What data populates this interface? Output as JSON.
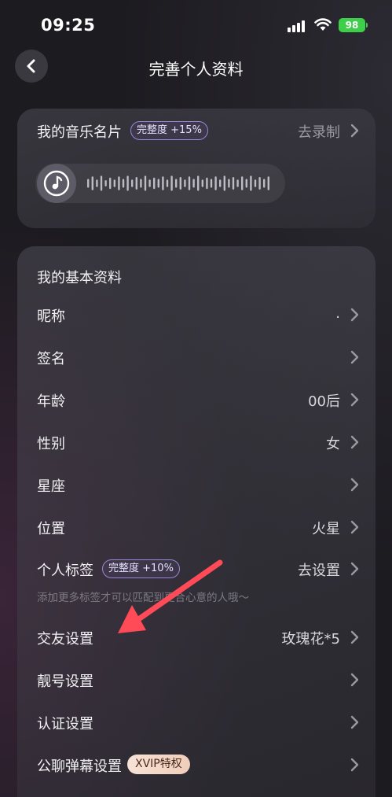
{
  "status_bar": {
    "time": "09:25",
    "battery": "98"
  },
  "header": {
    "title": "完善个人资料"
  },
  "music_card": {
    "title": "我的音乐名片",
    "badge": "完整度 +15%",
    "action": "去录制",
    "wave_heights": [
      0.35,
      0.55,
      0.3,
      0.6,
      0.25,
      0.45,
      0.3,
      0.55,
      0.35,
      0.6,
      0.3,
      0.5,
      0.35,
      0.6,
      0.3,
      0.45,
      0.35,
      0.55,
      0.3,
      0.6,
      0.35,
      0.5,
      0.3,
      0.55,
      0.35,
      0.6,
      0.3,
      0.45,
      0.35,
      0.55,
      0.3,
      0.6,
      0.35,
      0.5,
      0.3,
      0.55,
      0.35,
      0.6,
      0.3,
      0.5,
      0.35,
      0.55
    ]
  },
  "basic": {
    "title": "我的基本资料",
    "rows": {
      "nickname": {
        "label": "昵称",
        "value": "."
      },
      "signature": {
        "label": "签名",
        "value": ""
      },
      "age": {
        "label": "年龄",
        "value": "00后"
      },
      "gender": {
        "label": "性别",
        "value": "女"
      },
      "zodiac": {
        "label": "星座",
        "value": ""
      },
      "location": {
        "label": "位置",
        "value": "火星"
      },
      "tags": {
        "label": "个人标签",
        "badge": "完整度 +10%",
        "value": "去设置",
        "hint": "添加更多标签才可以匹配到更合心意的人哦～"
      },
      "friend": {
        "label": "交友设置",
        "value": "玫瑰花*5"
      },
      "pretty_id": {
        "label": "靓号设置",
        "value": ""
      },
      "verify": {
        "label": "认证设置",
        "value": ""
      },
      "danmaku": {
        "label": "公聊弹幕设置",
        "badge": "XVIP特权",
        "value": ""
      }
    }
  },
  "colors": {
    "accent_badge": "#9a86d6",
    "annotation_arrow": "#ff4a57",
    "battery": "#3ecf4a",
    "background": "#1c1b20"
  }
}
